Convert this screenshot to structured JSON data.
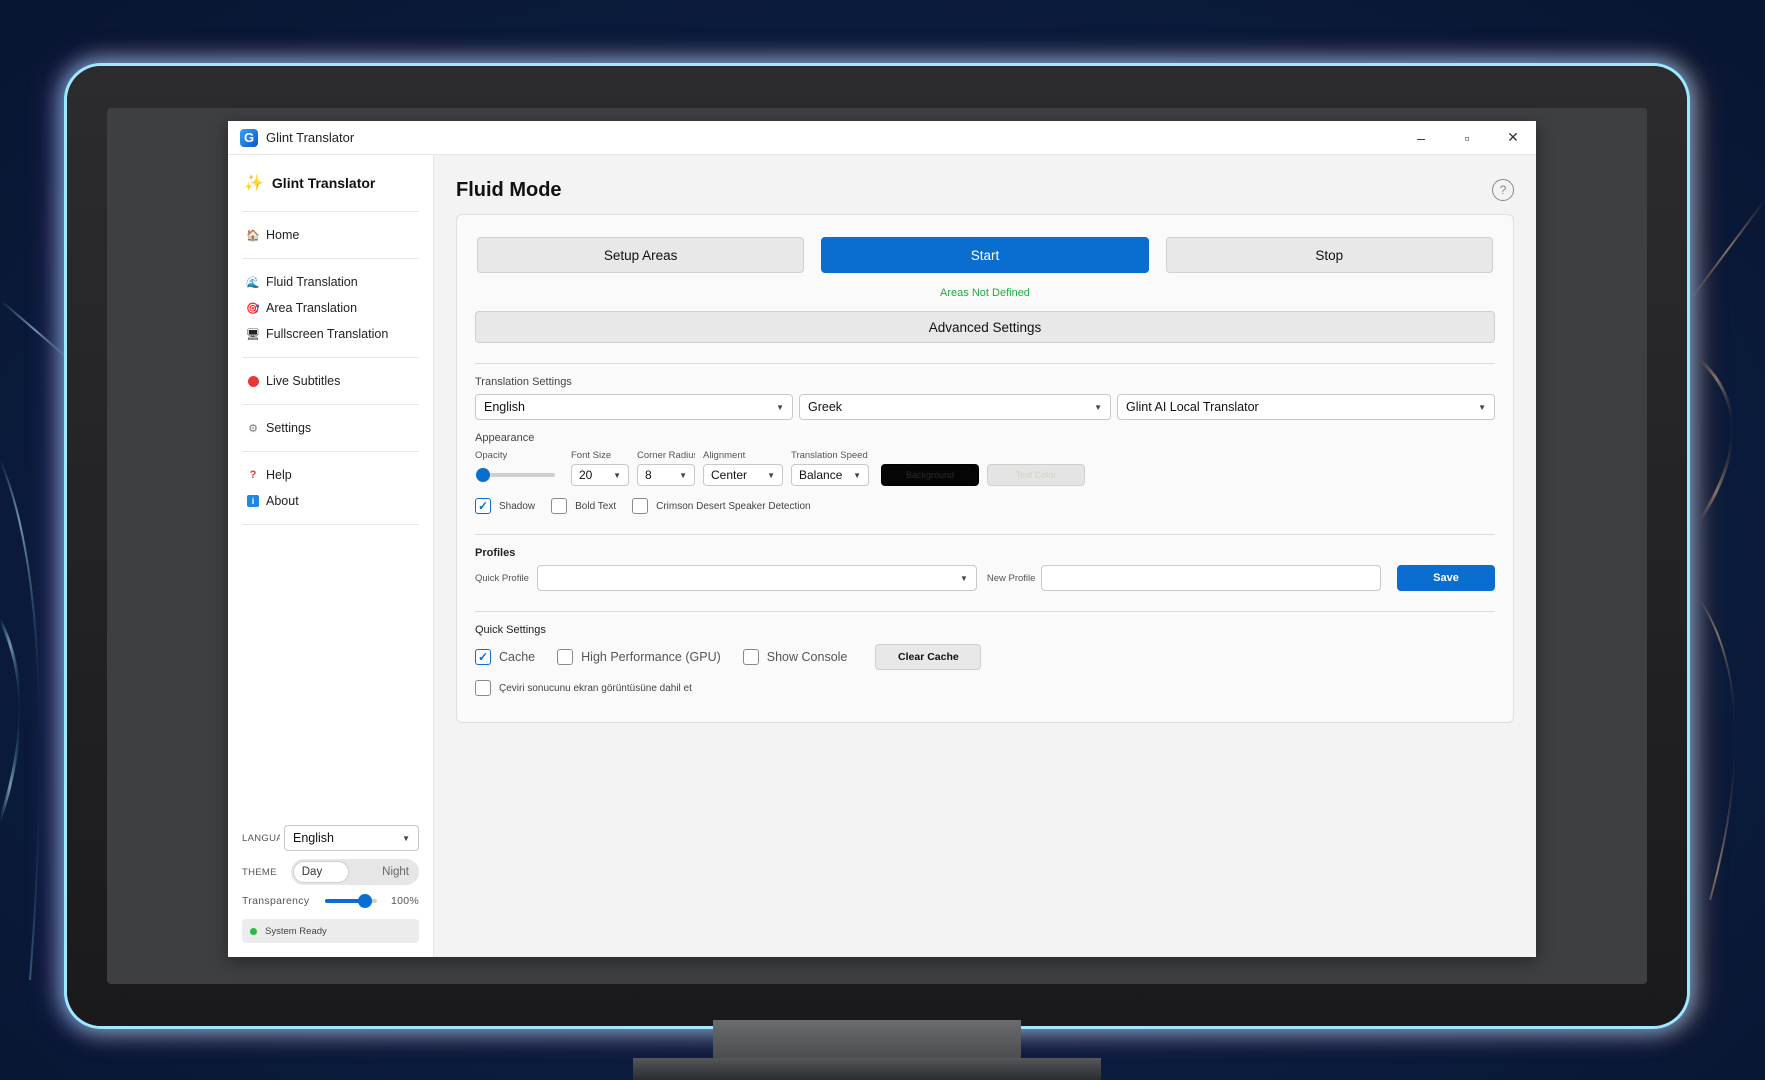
{
  "window": {
    "title": "Glint Translator",
    "minimize": "–",
    "maximize": "▫",
    "close": "✕",
    "logo_letter": "G"
  },
  "sidebar": {
    "brand": "Glint Translator",
    "groups": [
      [
        {
          "label": "Home",
          "icon": "house-icon"
        }
      ],
      [
        {
          "label": "Fluid Translation",
          "icon": "wave-icon"
        },
        {
          "label": "Area Translation",
          "icon": "target-icon"
        },
        {
          "label": "Fullscreen Translation",
          "icon": "monitor-icon"
        }
      ],
      [
        {
          "label": "Live Subtitles",
          "icon": "red-dot-icon"
        }
      ],
      [
        {
          "label": "Settings",
          "icon": "gear-icon"
        }
      ],
      [
        {
          "label": "Help",
          "icon": "question-icon"
        },
        {
          "label": "About",
          "icon": "info-icon"
        }
      ]
    ],
    "language_label": "LANGUA",
    "language_value": "English",
    "theme_label": "THEME",
    "theme_day": "Day",
    "theme_night": "Night",
    "transparency_label": "Transparency",
    "transparency_value": "100%",
    "transparency_level": 0.76,
    "status": "System Ready"
  },
  "main": {
    "title": "Fluid Mode",
    "help": "?",
    "buttons": {
      "setup": "Setup Areas",
      "start": "Start",
      "stop": "Stop"
    },
    "areas_status": "Areas Not Defined",
    "advanced": "Advanced Settings",
    "translation": {
      "label": "Translation Settings",
      "source": "English",
      "target": "Greek",
      "engine": "Glint AI Local Translator"
    },
    "appearance": {
      "label": "Appearance",
      "opacity_label": "Opacity",
      "opacity_level": 0.0,
      "font_size_label": "Font Size",
      "font_size": "20",
      "corner_radius_label": "Corner Radius",
      "corner_radius": "8",
      "alignment_label": "Alignment",
      "alignment": "Center",
      "speed_label": "Translation Speed",
      "speed": "Balance",
      "background_btn": "Background",
      "text_color_btn": "Text Color",
      "shadow": "Shadow",
      "bold_text": "Bold Text",
      "speaker_detection": "Crimson Desert Speaker Detection"
    },
    "profiles": {
      "label": "Profiles",
      "quick_label": "Quick Profile",
      "quick_value": "",
      "new_label": "New Profile",
      "new_value": "",
      "save": "Save"
    },
    "quick_settings": {
      "label": "Quick Settings",
      "cache": "Cache",
      "gpu": "High Performance (GPU)",
      "console": "Show Console",
      "clear_cache": "Clear Cache",
      "screenshot_include": "Çeviri sonucunu ekran görüntüsüne dahil et"
    }
  },
  "colors": {
    "accent": "#0a6ed1",
    "status_ok": "#22aa44"
  }
}
